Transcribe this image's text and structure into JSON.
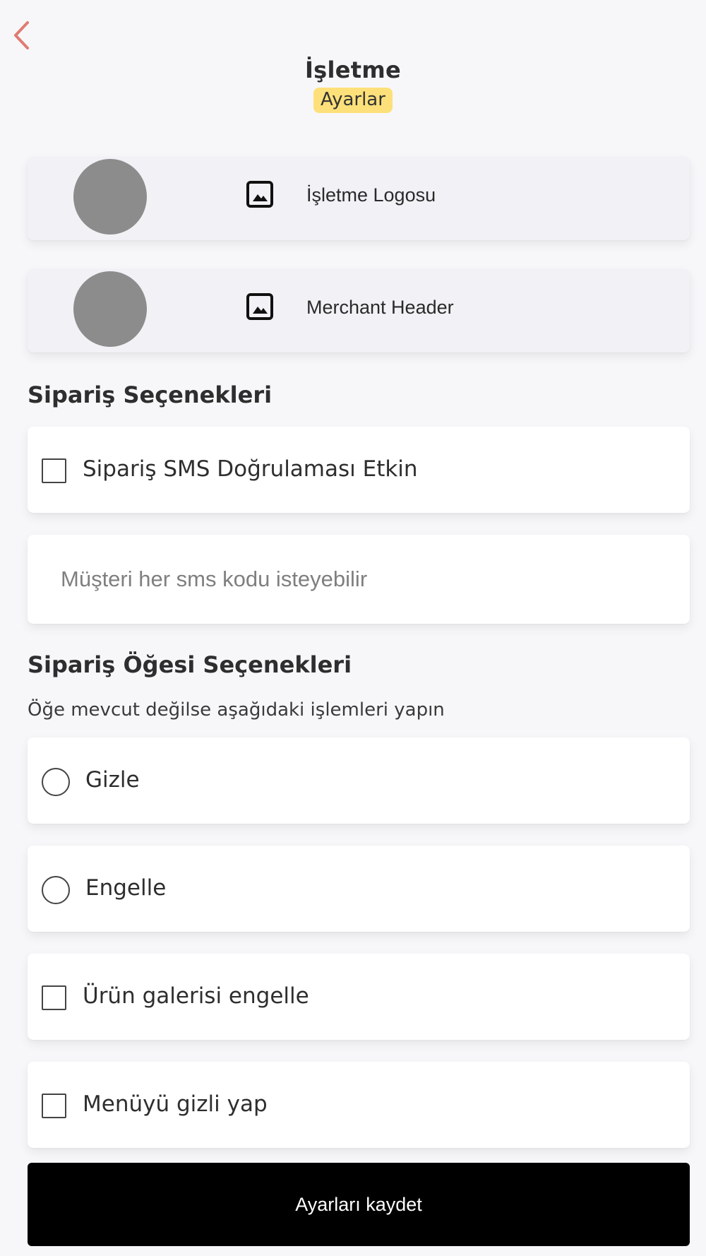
{
  "header": {
    "title": "İşletme",
    "badge": "Ayarlar",
    "back_icon": "chevron-left-icon",
    "accent_color": "#e07b72",
    "badge_color": "#fde07a"
  },
  "images": [
    {
      "label": "İşletme Logosu",
      "icon": "image-icon"
    },
    {
      "label": "Merchant Header",
      "icon": "image-icon"
    }
  ],
  "order_options": {
    "title": "Sipariş Seçenekleri",
    "sms_verification": {
      "label": "Sipariş SMS Doğrulaması Etkin",
      "checked": false
    },
    "sms_input": {
      "value": "",
      "placeholder": "Müşteri her sms kodu isteyebilir"
    }
  },
  "item_options": {
    "title": "Sipariş Öğesi Seçenekleri",
    "helper": "Öğe mevcut değilse aşağıdaki işlemleri yapın",
    "radios": [
      {
        "label": "Gizle",
        "selected": false
      },
      {
        "label": "Engelle",
        "selected": false
      }
    ],
    "checkboxes": [
      {
        "label": "Ürün galerisi engelle",
        "checked": false
      },
      {
        "label": "Menüyü gizli yap",
        "checked": false
      }
    ]
  },
  "save_button": {
    "label": "Ayarları kaydet",
    "color": "#000000"
  }
}
